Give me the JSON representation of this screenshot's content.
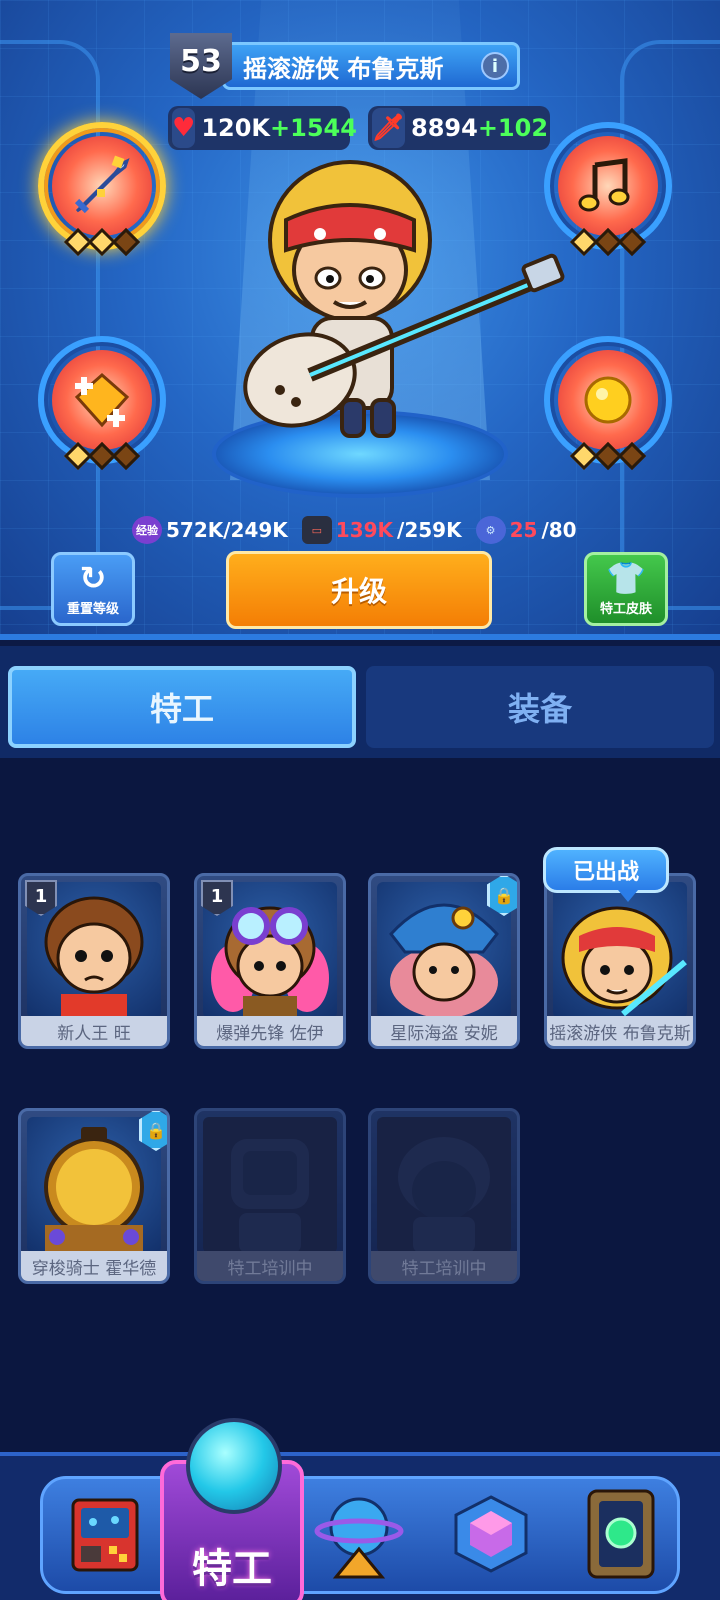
{
  "hero": {
    "level": "53",
    "name": "摇滚游侠 布鲁克斯",
    "hp": "120K",
    "hp_bonus": "+1544",
    "attack": "8894",
    "attack_bonus": "+102",
    "exp_badge": "经验",
    "exp": "572K/249K",
    "tape_have": "139K",
    "tape_need": "/259K",
    "part_have": "25",
    "part_need": "/80",
    "reset_label": "重置等级",
    "upgrade_label": "升级",
    "skin_label": "特工皮肤",
    "skills": [
      {
        "name": "sword",
        "gems": [
          true,
          true,
          false
        ]
      },
      {
        "name": "music-note",
        "gems": [
          true,
          false,
          false
        ]
      },
      {
        "name": "gem-plus",
        "gems": [
          true,
          false,
          false
        ]
      },
      {
        "name": "gold-coin",
        "gems": [
          true,
          false,
          false
        ]
      }
    ]
  },
  "tabs": {
    "agents": "特工",
    "equipment": "装备"
  },
  "agents": [
    {
      "name": "新人王 旺",
      "level": "1"
    },
    {
      "name": "爆弹先锋 佐伊",
      "level": "1"
    },
    {
      "name": "星际海盗 安妮"
    },
    {
      "name": "摇滚游侠 布鲁克斯",
      "tag": "已出战"
    },
    {
      "name": "穿梭骑士 霍华德"
    },
    {
      "name": "特工培训中"
    },
    {
      "name": "特工培训中"
    }
  ],
  "bottom_nav": {
    "active_label": "特工"
  }
}
